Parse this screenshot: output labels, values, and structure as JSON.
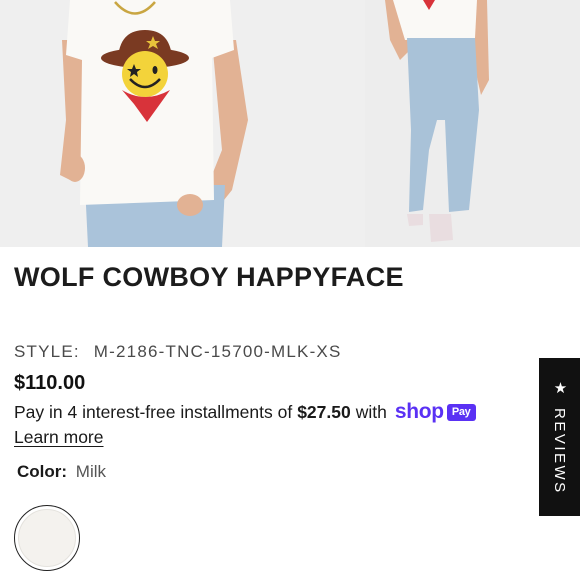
{
  "product": {
    "title": "WOLF COWBOY HAPPYFACE",
    "style_label": "STYLE:",
    "style_value": "M-2186-TNC-15700-MLK-XS",
    "price": "$110.00"
  },
  "installments": {
    "prefix": "Pay in 4 interest-free installments of",
    "amount": "$27.50",
    "suffix": "with",
    "brand": "shop",
    "brand_badge": "Pay",
    "learn_more": "Learn more"
  },
  "color": {
    "label": "Color:",
    "value": "Milk",
    "swatch_hex": "#f4f2ee"
  },
  "reviews_tab": {
    "star": "★",
    "label": "REVIEWS"
  },
  "theme": {
    "shop_pay_purple": "#5a31f4",
    "tab_background": "#111111"
  }
}
